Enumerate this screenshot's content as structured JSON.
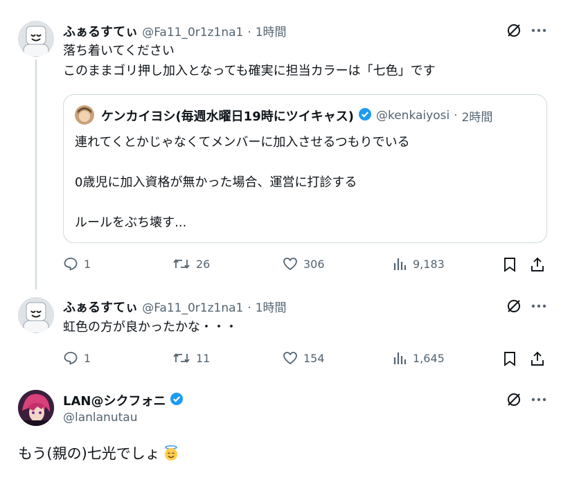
{
  "tweet1": {
    "name": "ふぁるすてぃ",
    "handle": "@Fa11_0r1z1na1",
    "sep": "·",
    "time": "1時間",
    "lines": [
      "落ち着いてください",
      "このままゴリ押し加入となっても確実に担当カラーは「七色」です"
    ],
    "quote": {
      "name": "ケンカイヨシ(毎週水曜日19時にツイキャス)",
      "handle": "@kenkaiyosi",
      "sep": "·",
      "time": "2時間",
      "lines": [
        "連れてくとかじゃなくてメンバーに加入させるつもりでいる",
        "0歳児に加入資格が無かった場合、運営に打診する",
        "ルールをぶち壊す..."
      ]
    },
    "actions": {
      "replies": "1",
      "retweets": "26",
      "likes": "306",
      "views": "9,183"
    }
  },
  "tweet2": {
    "name": "ふぁるすてぃ",
    "handle": "@Fa11_0r1z1na1",
    "sep": "·",
    "time": "1時間",
    "text": "虹色の方が良かったかな・・・",
    "actions": {
      "replies": "1",
      "retweets": "11",
      "likes": "154",
      "views": "1,645"
    }
  },
  "main_tweet": {
    "name": "LAN@シクフォニ",
    "handle": "@lanlanutau",
    "text": "もう(親の)七光でしょ",
    "emoji": "😇"
  },
  "icons": {
    "more": "more-icon",
    "grok": "grok-icon",
    "reply": "reply-icon",
    "retweet": "retweet-icon",
    "like": "like-icon",
    "views": "views-icon",
    "bookmark": "bookmark-icon",
    "share": "share-icon",
    "verified": "verified-badge-icon"
  },
  "colors": {
    "accent": "#1d9bf0",
    "muted": "#536471",
    "text": "#0f1419",
    "border": "#cfd9de"
  }
}
